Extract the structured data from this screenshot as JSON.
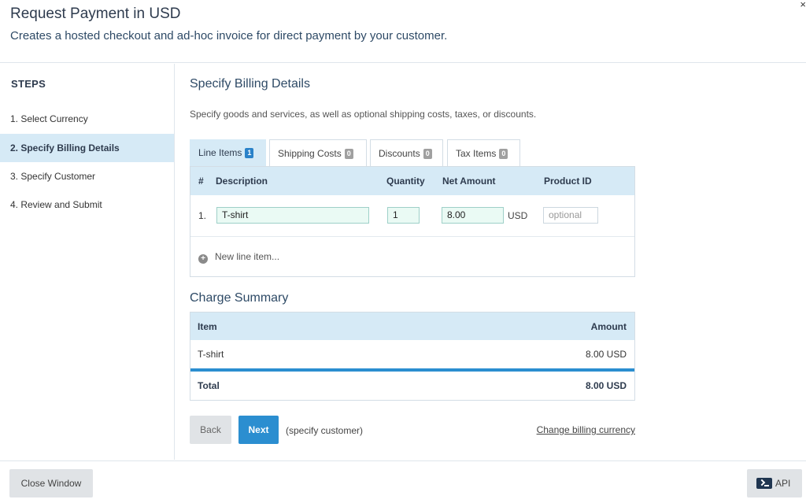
{
  "header": {
    "title": "Request Payment in USD",
    "subtitle": "Creates a hosted checkout and ad-hoc invoice for direct payment by your customer.",
    "close_glyph": "×"
  },
  "sidebar": {
    "title": "STEPS",
    "steps": [
      {
        "label": "1. Select Currency",
        "active": false
      },
      {
        "label": "2. Specify Billing Details",
        "active": true
      },
      {
        "label": "3. Specify Customer",
        "active": false
      },
      {
        "label": "4. Review and Submit",
        "active": false
      }
    ]
  },
  "main": {
    "title": "Specify Billing Details",
    "description": "Specify goods and services, as well as optional shipping costs, taxes, or discounts.",
    "tabs": [
      {
        "label": "Line Items",
        "count": "1",
        "active": true
      },
      {
        "label": "Shipping Costs",
        "count": "0",
        "active": false
      },
      {
        "label": "Discounts",
        "count": "0",
        "active": false
      },
      {
        "label": "Tax Items",
        "count": "0",
        "active": false
      }
    ],
    "line_items": {
      "headers": {
        "num": "#",
        "description": "Description",
        "quantity": "Quantity",
        "net_amount": "Net Amount",
        "product_id": "Product ID"
      },
      "rows": [
        {
          "num": "1.",
          "description": "T-shirt",
          "quantity": "1",
          "net_amount": "8.00",
          "currency": "USD",
          "product_id_placeholder": "optional"
        }
      ],
      "add_label": "New line item..."
    },
    "summary": {
      "title": "Charge Summary",
      "headers": {
        "item": "Item",
        "amount": "Amount"
      },
      "rows": [
        {
          "item": "T-shirt",
          "amount": "8.00 USD"
        }
      ],
      "total": {
        "label": "Total",
        "amount": "8.00 USD"
      }
    },
    "actions": {
      "back": "Back",
      "next": "Next",
      "next_hint": "(specify customer)",
      "change_currency": "Change billing currency"
    }
  },
  "footer": {
    "close": "Close Window",
    "api": "API"
  },
  "colors": {
    "accent": "#2b8ed0",
    "header_bg": "#d6eaf6",
    "field_bg": "#eafaf4"
  }
}
